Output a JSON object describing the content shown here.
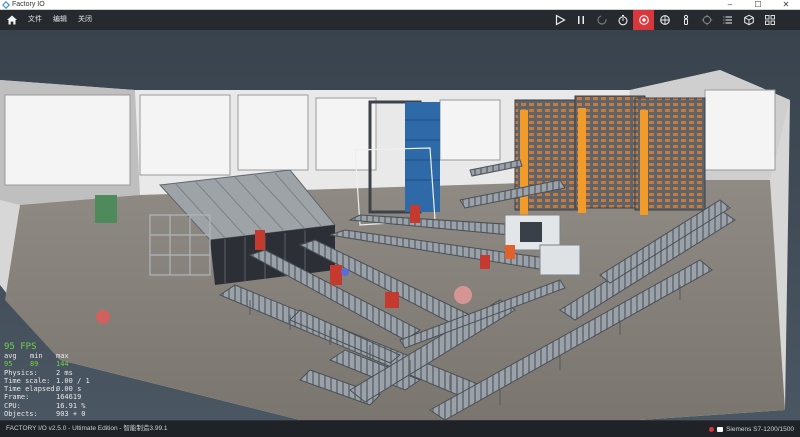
{
  "window": {
    "title": "Factory IO",
    "minimize": "–",
    "maximize": "☐",
    "close": "✕"
  },
  "menu": {
    "items": [
      {
        "label": "文件"
      },
      {
        "label": "编辑"
      },
      {
        "label": "关闭"
      }
    ]
  },
  "toolbar": {
    "buttons": [
      {
        "icon": "play-icon"
      },
      {
        "icon": "pause-icon"
      },
      {
        "icon": "reset-icon"
      },
      {
        "icon": "timer-icon"
      },
      {
        "icon": "camera-orbit-icon",
        "active": true
      },
      {
        "icon": "camera-fly-icon"
      },
      {
        "icon": "first-person-icon"
      },
      {
        "icon": "target-icon"
      },
      {
        "icon": "list-icon"
      },
      {
        "icon": "cube-icon"
      },
      {
        "icon": "grid-icon"
      }
    ],
    "active_color": "#d8373b"
  },
  "stats": {
    "fps_value": "95",
    "fps_label": "FPS",
    "header": [
      "avg",
      "min",
      "max"
    ],
    "values": [
      "95",
      "89",
      "144"
    ],
    "rows": [
      {
        "label": "Physics:",
        "value": "2 ms"
      },
      {
        "label": "Time scale:",
        "value": "1.00 / 1"
      },
      {
        "label": "Time elapsed:",
        "value": "0.00 s"
      },
      {
        "label": "Frame:",
        "value": "164619"
      },
      {
        "label": "CPU:",
        "value": "16.91 %"
      },
      {
        "label": "Objects:",
        "value": "903 + 0"
      }
    ]
  },
  "statusbar": {
    "edition": "FACTORY I/O v2.5.0 - Ultimate Edition - 智能制造3.99.1",
    "driver": "Siemens S7-1200/1500"
  }
}
